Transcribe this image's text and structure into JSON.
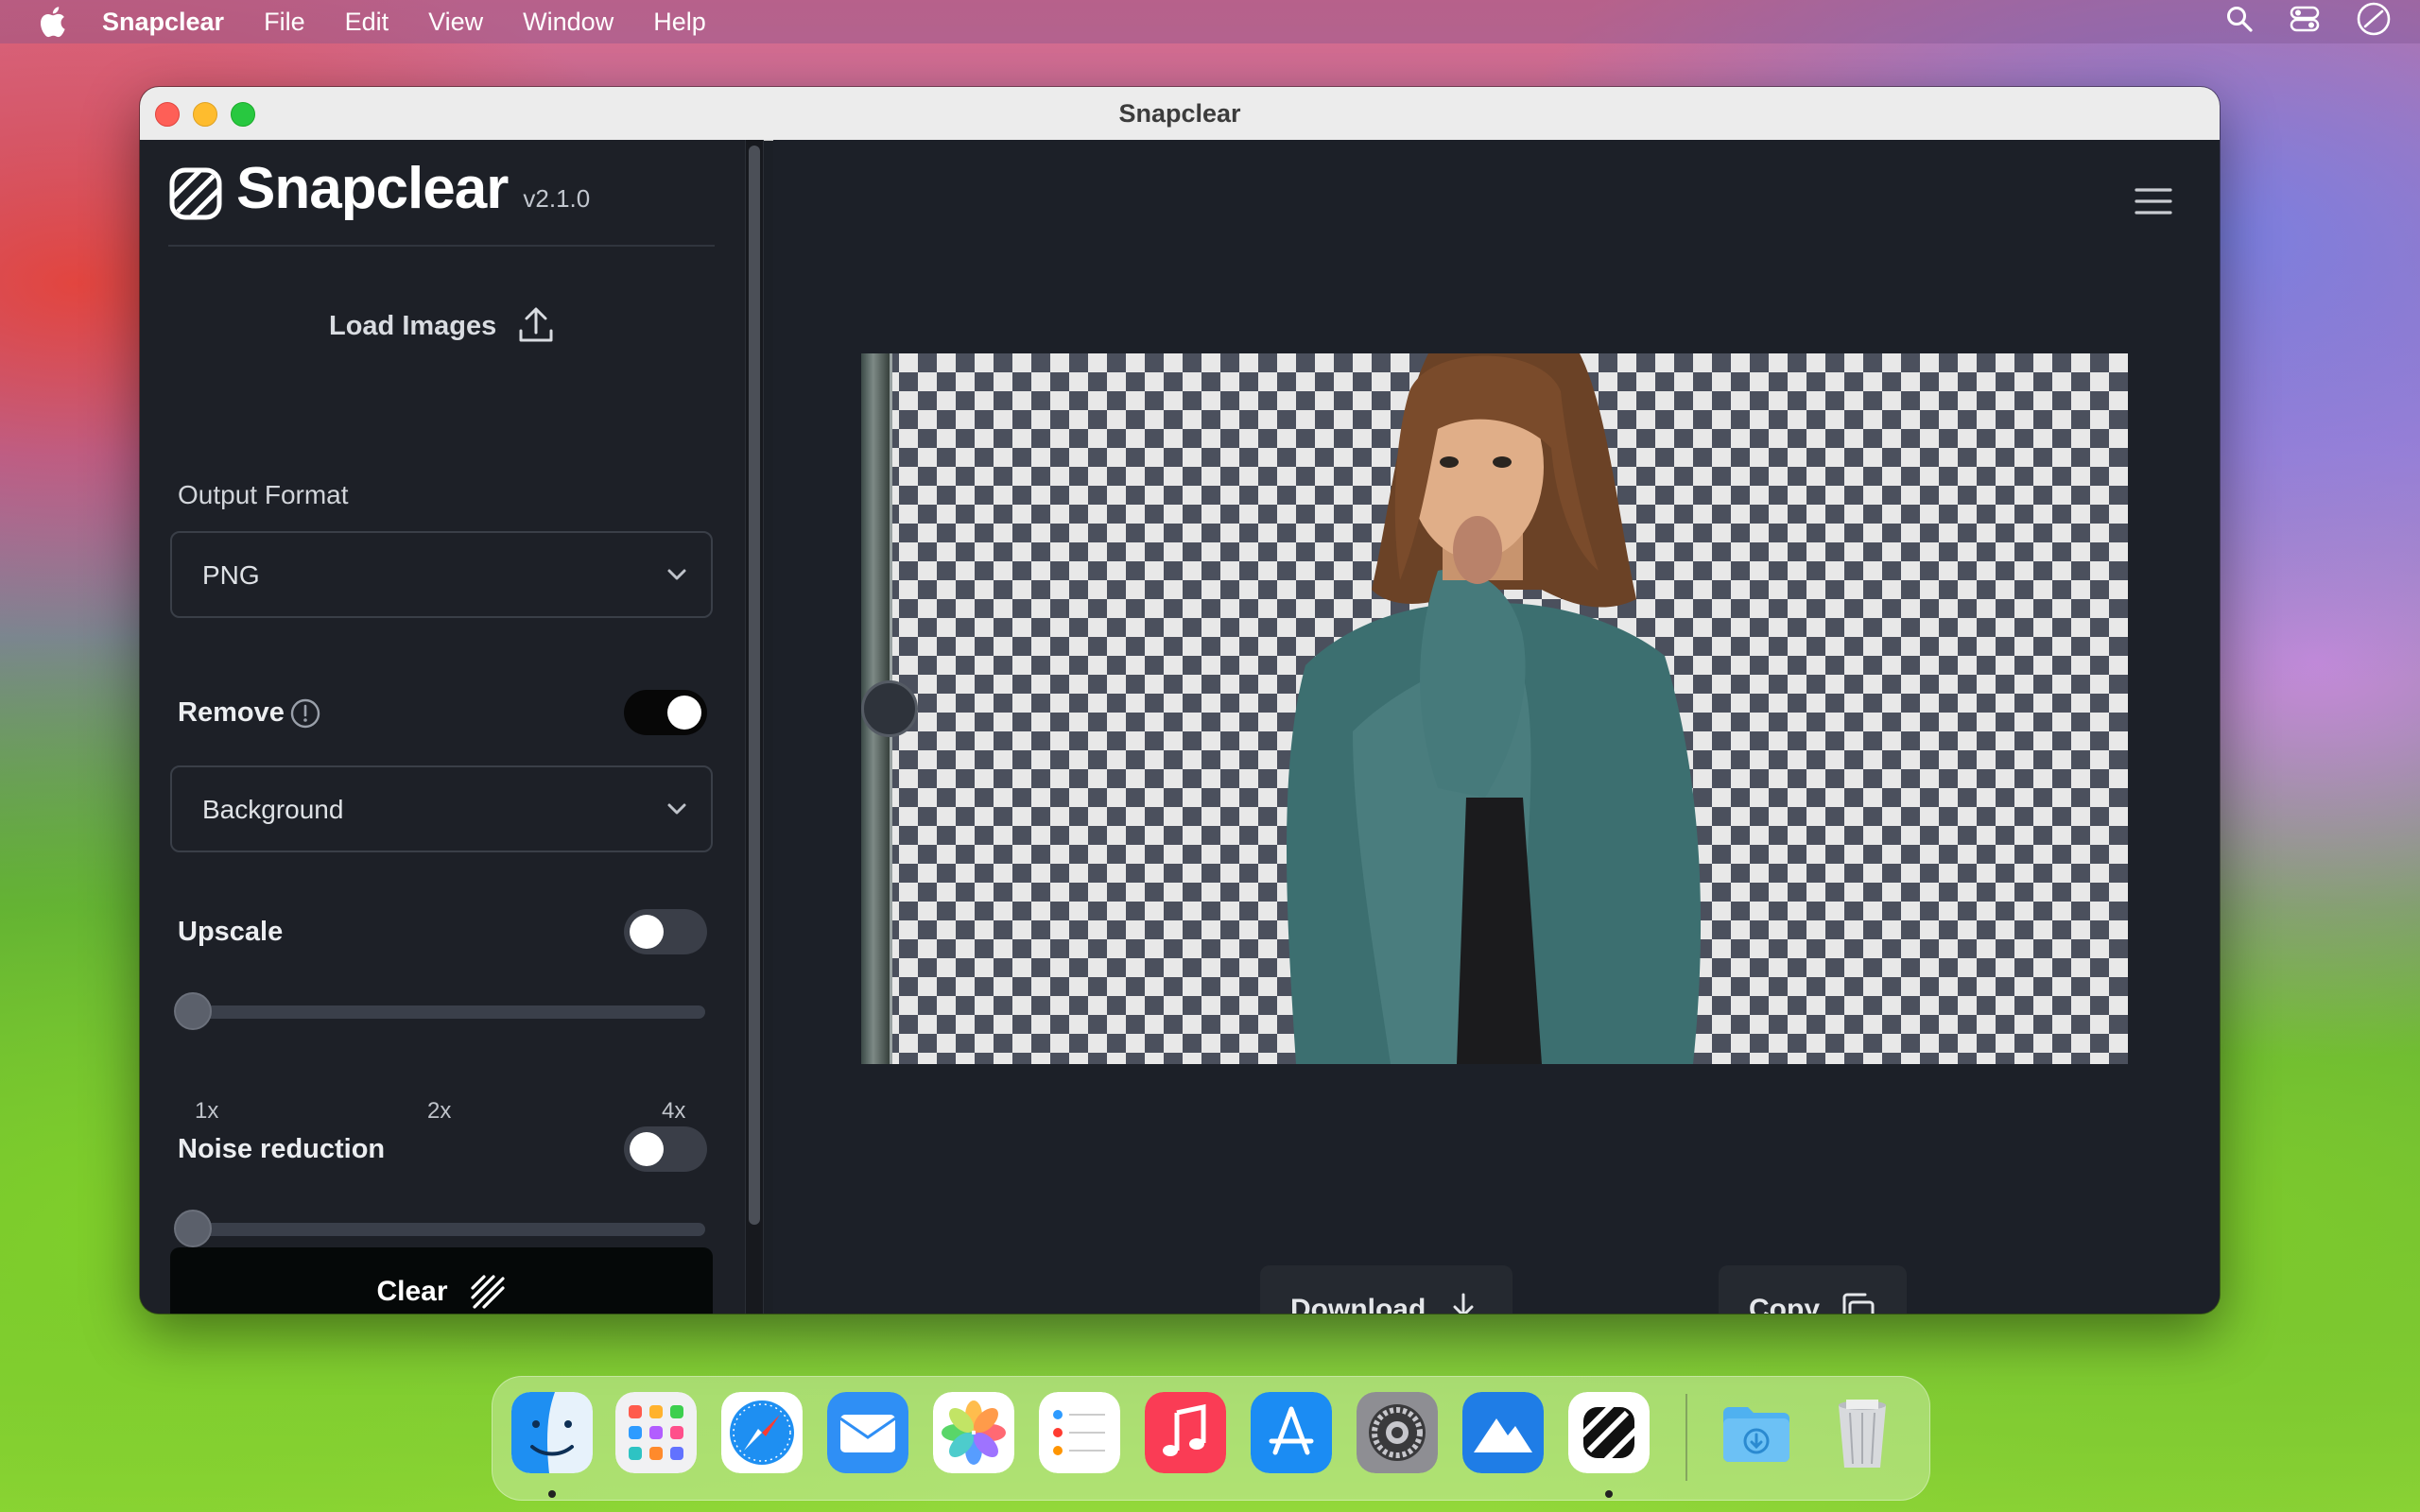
{
  "menubar": {
    "app_name": "Snapclear",
    "items": [
      "File",
      "Edit",
      "View",
      "Window",
      "Help"
    ]
  },
  "window": {
    "title": "Snapclear"
  },
  "sidebar": {
    "logo_text": "Snapclear",
    "version": "v2.1.0",
    "load_images_label": "Load Images",
    "output_format": {
      "label": "Output Format",
      "value": "PNG"
    },
    "remove": {
      "label": "Remove",
      "enabled": true,
      "value": "Background"
    },
    "upscale": {
      "label": "Upscale",
      "enabled": false,
      "ticks": [
        "1x",
        "2x",
        "4x"
      ],
      "value": "1x"
    },
    "noise_reduction": {
      "label": "Noise reduction",
      "enabled": false,
      "value": 0
    },
    "clear_label": "Clear"
  },
  "main": {
    "download_label": "Download",
    "copy_label": "Copy",
    "compare_split": 0.02
  },
  "colors": {
    "sidebar_bg": "#1d2027",
    "main_bg": "#1c2028",
    "toggle_on": "#070707",
    "button_bg": "#252930"
  },
  "dock": {
    "apps": [
      "finder-icon",
      "launchpad-icon",
      "safari-icon",
      "mail-icon",
      "photos-icon",
      "reminders-icon",
      "music-icon",
      "app-store-icon",
      "system-settings-icon",
      "altitude-icon",
      "snapclear-icon",
      "downloads-folder-icon",
      "trash-icon"
    ]
  }
}
